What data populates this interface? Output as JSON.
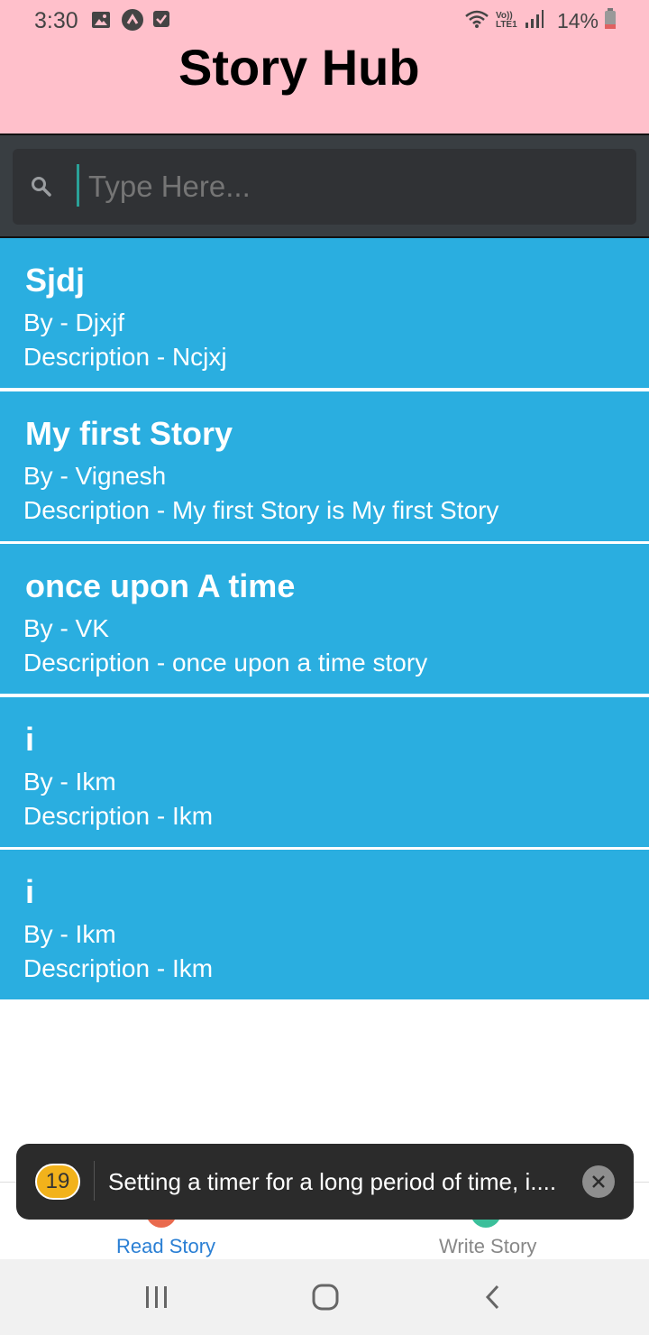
{
  "status_bar": {
    "time": "3:30",
    "battery_percent": "14%",
    "network_label": "Vo)) LTE1",
    "left_icons": [
      "image-icon",
      "arrow-up-icon",
      "check-box-icon"
    ],
    "right_icons": [
      "wifi-icon",
      "signal-icon",
      "battery-icon"
    ]
  },
  "app": {
    "title": "Story Hub"
  },
  "search": {
    "placeholder": "Type Here...",
    "value": ""
  },
  "stories": [
    {
      "title": "Sjdj",
      "author": "By - Djxjf",
      "description": "Description - Ncjxj"
    },
    {
      "title": "My first Story",
      "author": "By - Vignesh",
      "description": "Description - My first Story is My first Story"
    },
    {
      "title": "once upon A time",
      "author": "By - VK",
      "description": "Description - once upon a time story"
    },
    {
      "title": "i",
      "author": "By - Ikm",
      "description": "Description - Ikm"
    },
    {
      "title": "i",
      "author": "By - Ikm",
      "description": "Description - Ikm"
    }
  ],
  "tabs": {
    "read": {
      "label": "Read Story",
      "active": true
    },
    "write": {
      "label": "Write Story",
      "active": false
    }
  },
  "toast": {
    "count": "19",
    "message": "Setting a timer for a long period of time, i...."
  },
  "colors": {
    "header_bg": "#ffc0cb",
    "card_bg": "#2aaee0",
    "search_bg": "#393e42",
    "active_tab": "#2a7fd4",
    "toast_badge": "#f2b21b"
  }
}
